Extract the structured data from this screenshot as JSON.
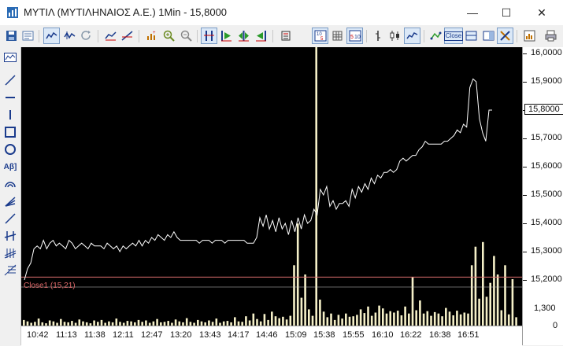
{
  "window": {
    "title": "ΜΥΤΙΛ (ΜΥΤΙΛΗΝΑΙΟΣ Α.Ε.) 1Min - 15,8000",
    "minimize_glyph": "—",
    "maximize_glyph": "☐",
    "close_glyph": "✕"
  },
  "toolbar": {
    "close_label": "Close"
  },
  "left_tools": [
    "line-chart-icon",
    "diagonal-line-icon",
    "horizontal-line-icon",
    "vertical-line-icon",
    "rectangle-icon",
    "circle-icon",
    "text-icon",
    "arc-icon",
    "fan-icon",
    "trend-line-icon",
    "channel-icon",
    "grid-icon",
    "fibonacci-icon"
  ],
  "left_text_tool": "Aβ]",
  "chart": {
    "indicator_label": "Close1 (15,21)",
    "current_price_label": "15,8000",
    "colors": {
      "background": "#000000",
      "price_line": "#ffffff",
      "volume_bars": "#f5f0c8",
      "reference_line": "#e07070"
    }
  },
  "chart_data": {
    "type": "line",
    "x_ticks": [
      "10:42",
      "11:13",
      "11:38",
      "12:11",
      "12:47",
      "13:20",
      "13:43",
      "14:17",
      "14:46",
      "15:09",
      "15:38",
      "15:55",
      "16:10",
      "16:22",
      "16:38",
      "16:51"
    ],
    "y_ticks": [
      "16,0000",
      "15,9000",
      "15,8000",
      "15,7000",
      "15,6000",
      "15,5000",
      "15,4000",
      "15,3000",
      "15,2000"
    ],
    "volume_ticks": [
      "1,300",
      "0"
    ],
    "ylim": [
      15.15,
      16.0
    ],
    "reference_value": 15.21,
    "last_value": 15.8,
    "series": [
      {
        "values": [
          15.2,
          15.24,
          15.26,
          15.31,
          15.32,
          15.31,
          15.34,
          15.31,
          15.33,
          15.34,
          15.32,
          15.33,
          15.32,
          15.31,
          15.34,
          15.33,
          15.31,
          15.32,
          15.33,
          15.32,
          15.31,
          15.33,
          15.32,
          15.32,
          15.32,
          15.31,
          15.33,
          15.32,
          15.31,
          15.32,
          15.3,
          15.32,
          15.31,
          15.32,
          15.33,
          15.32,
          15.34,
          15.32,
          15.34,
          15.33,
          15.35,
          15.34,
          15.36,
          15.35,
          15.34,
          15.36,
          15.35,
          15.37,
          15.35,
          15.34,
          15.34,
          15.34,
          15.34,
          15.34,
          15.34,
          15.33,
          15.34,
          15.34,
          15.34,
          15.33,
          15.34,
          15.34,
          15.34,
          15.33,
          15.34,
          15.34,
          15.34,
          15.34,
          15.34,
          15.34,
          15.33,
          15.33,
          15.33,
          15.35,
          15.42,
          15.39,
          15.43,
          15.38,
          15.41,
          15.37,
          15.42,
          15.38,
          15.4,
          15.36,
          15.41,
          15.37,
          15.42,
          15.38,
          15.43,
          15.4,
          15.41,
          15.45,
          15.43,
          15.52,
          15.5,
          15.53,
          15.46,
          15.48,
          15.45,
          15.47,
          15.47,
          15.48,
          15.46,
          15.52,
          15.49,
          15.53,
          15.51,
          15.54,
          15.52,
          15.56,
          15.54,
          15.57,
          15.56,
          15.58,
          15.58,
          15.59,
          15.58,
          15.59,
          15.62,
          15.63,
          15.62,
          15.63,
          15.64,
          15.64,
          15.66,
          15.67,
          15.69,
          15.68,
          15.68,
          15.68,
          15.68,
          15.68,
          15.69,
          15.69,
          15.7,
          15.71,
          15.73,
          15.72,
          15.75,
          15.74,
          15.88,
          15.91,
          15.9,
          15.77,
          15.72,
          15.69,
          15.8,
          15.8
        ]
      }
    ],
    "volume": [
      120,
      90,
      60,
      80,
      150,
      70,
      50,
      110,
      90,
      60,
      140,
      80,
      70,
      100,
      60,
      130,
      90,
      70,
      50,
      110,
      80,
      120,
      60,
      90,
      70,
      150,
      80,
      60,
      100,
      90,
      70,
      120,
      80,
      110,
      60,
      90,
      140,
      70,
      80,
      100,
      60,
      130,
      90,
      70,
      160,
      80,
      60,
      120,
      90,
      70,
      110,
      80,
      150,
      60,
      90,
      100,
      70,
      180,
      90,
      80,
      200,
      110,
      260,
      140,
      90,
      250,
      120,
      300,
      200,
      160,
      190,
      130,
      210,
      1300,
      2200,
      600,
      1100,
      350,
      210,
      6000,
      560,
      300,
      180,
      260,
      120,
      230,
      150,
      260,
      190,
      200,
      230,
      350,
      270,
      410,
      210,
      280,
      430,
      370,
      260,
      310,
      280,
      320,
      220,
      410,
      260,
      1050,
      330,
      540,
      260,
      310,
      210,
      290,
      260,
      200,
      380,
      300,
      220,
      320,
      240,
      280,
      260,
      1300,
      1700,
      580,
      1800,
      620,
      920,
      1500,
      1100,
      330,
      1300,
      240,
      1000,
      180
    ]
  }
}
